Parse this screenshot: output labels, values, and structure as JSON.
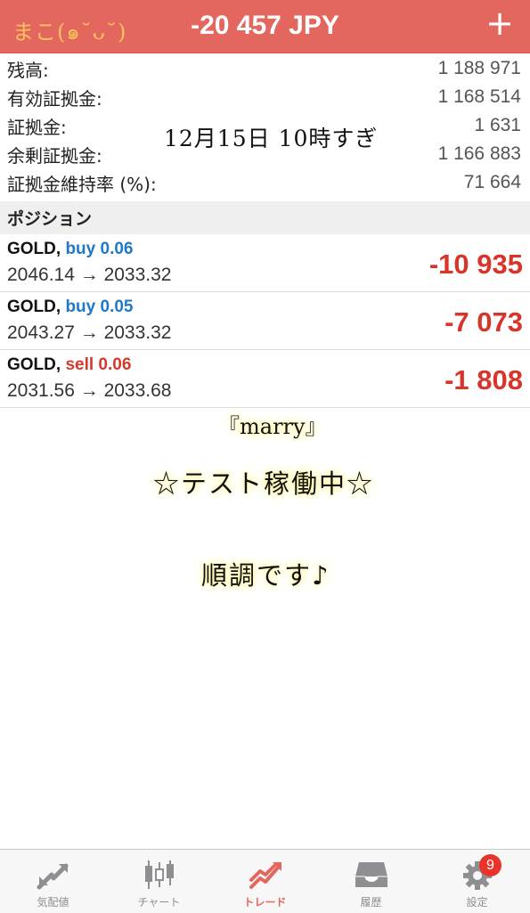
{
  "header": {
    "user": "まこ(๑˘ᴗ˘)",
    "total": "-20 457 JPY",
    "plus_icon": "plus-icon"
  },
  "summary": [
    {
      "label": "残高:",
      "value": "1 188 971"
    },
    {
      "label": "有効証拠金:",
      "value": "1 168 514"
    },
    {
      "label": "証拠金:",
      "value": "1 631"
    },
    {
      "label": "余剰証拠金:",
      "value": "1 166 883"
    },
    {
      "label": "証拠金維持率 (%):",
      "value": "71 664"
    }
  ],
  "section_title": "ポジション",
  "positions": [
    {
      "symbol": "GOLD,",
      "direction": "buy 0.06",
      "prices": "2046.14 → 2033.32",
      "profit": "-10 935"
    },
    {
      "symbol": "GOLD,",
      "direction": "buy 0.05",
      "prices": "2043.27 → 2033.32",
      "profit": "-7 073"
    },
    {
      "symbol": "GOLD,",
      "direction": "sell 0.06",
      "prices": "2031.56 → 2033.68",
      "profit": "-1 808"
    }
  ],
  "notes": {
    "date": "12月15日 10時すぎ",
    "marry": "『marry』",
    "test": "☆テスト稼働中☆",
    "smooth": "順調です♪"
  },
  "tabs": [
    {
      "label": "気配値",
      "icon": "quotes-arrows-icon"
    },
    {
      "label": "チャート",
      "icon": "candlestick-chart-icon"
    },
    {
      "label": "トレード",
      "icon": "trade-trend-icon"
    },
    {
      "label": "履歴",
      "icon": "history-inbox-icon"
    },
    {
      "label": "設定",
      "icon": "gear-icon",
      "badge": "9"
    }
  ],
  "colors": {
    "header_bg": "#e4675f",
    "buy": "#1f78c8",
    "sell": "#d23a2e",
    "loss": "#d8342a",
    "active_tab": "#e4675f"
  }
}
